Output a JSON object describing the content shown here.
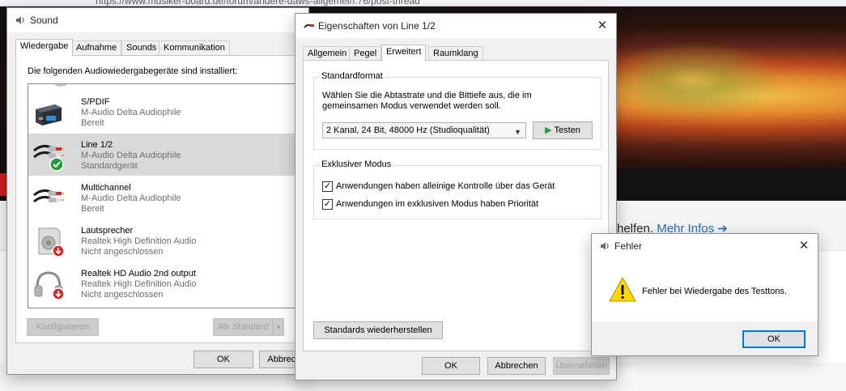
{
  "browser": {
    "url": "https://www.musiker-board.de/forum/andere-daws-allgemein.76/post-thread",
    "more_text": "helfen.",
    "more_link": "Mehr Infos ➔"
  },
  "sound": {
    "title": "Sound",
    "tabs": [
      "Wiedergabe",
      "Aufnahme",
      "Sounds",
      "Kommunikation"
    ],
    "list_label": "Die folgenden Audiowiedergabegeräte sind installiert:",
    "devices": [
      {
        "name": "S/PDIF",
        "line1": "M-Audio Delta Audiophile",
        "line2": "Bereit",
        "icon": "spdif-device-icon"
      },
      {
        "name": "Line 1/2",
        "line1": "M-Audio Delta Audiophile",
        "line2": "Standardgerät",
        "icon": "line-cable-default-icon"
      },
      {
        "name": "Multichannel",
        "line1": "M-Audio Delta Audiophile",
        "line2": "Bereit",
        "icon": "line-cable-icon"
      },
      {
        "name": "Lautsprecher",
        "line1": "Realtek High Definition Audio",
        "line2": "Nicht angeschlossen",
        "icon": "speaker-disconnected-icon"
      },
      {
        "name": "Realtek HD Audio 2nd output",
        "line1": "Realtek High Definition Audio",
        "line2": "Nicht angeschlossen",
        "icon": "headphones-disconnected-icon"
      }
    ],
    "configure_label": "Konfigurieren",
    "set_default_label": "Als Standard",
    "ok_label": "OK",
    "cancel_label": "Abbrechen"
  },
  "props": {
    "title": "Eigenschaften von Line 1/2",
    "tabs": [
      "Allgemein",
      "Pegel",
      "Erweitert",
      "Raumklang"
    ],
    "default_format_title": "Standardformat",
    "default_format_desc1": "Wählen Sie die Abtastrate und die Bittiefe aus, die im",
    "default_format_desc2": "gemeinsamen Modus verwendet werden soll.",
    "format_value": "2 Kanal, 24 Bit, 48000 Hz (Studioqualität)",
    "test_label": "Testen",
    "exclusive_title": "Exklusiver Modus",
    "exclusive_opt1": "Anwendungen haben alleinige Kontrolle über das Gerät",
    "exclusive_opt2": "Anwendungen im exklusiven Modus haben Priorität",
    "restore_label": "Standards wiederherstellen",
    "ok_label": "OK",
    "cancel_label": "Abbrechen",
    "apply_label": "Übernehmen"
  },
  "error": {
    "title": "Fehler",
    "message": "Fehler bei Wiedergabe des Testtons.",
    "ok_label": "OK"
  },
  "colors": {
    "accent_focus": "#0078d7",
    "success_green": "#1e9e3a",
    "disconnected_red": "#d32626",
    "warning_yellow": "#ffd800"
  }
}
